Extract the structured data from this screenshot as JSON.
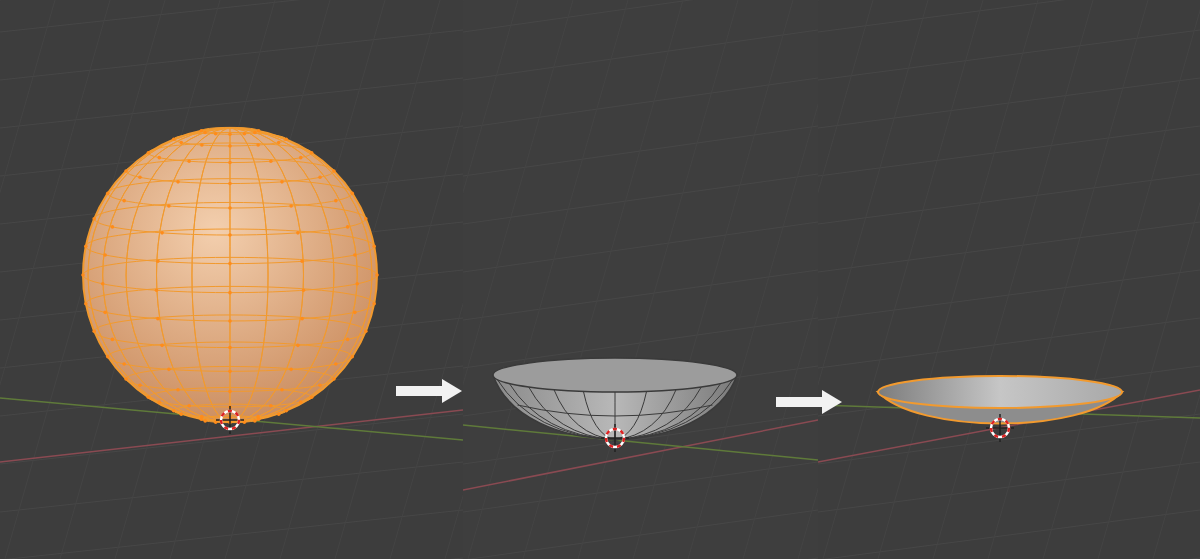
{
  "viewports": [
    {
      "object": {
        "kind": "sphere",
        "selected": true
      }
    },
    {
      "object": {
        "kind": "bowl",
        "selected": false
      }
    },
    {
      "object": {
        "kind": "dish",
        "selected": true
      }
    }
  ]
}
